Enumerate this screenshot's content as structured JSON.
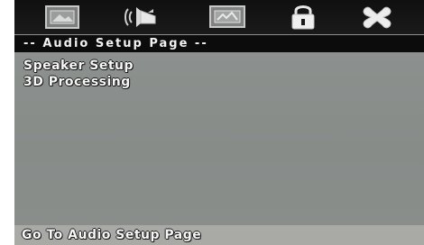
{
  "toolbar": {
    "icons": [
      {
        "name": "general-setup-icon"
      },
      {
        "name": "audio-setup-icon"
      },
      {
        "name": "video-setup-icon"
      },
      {
        "name": "preference-lock-icon"
      },
      {
        "name": "exit-icon"
      }
    ]
  },
  "header": {
    "title": "-- Audio Setup Page --"
  },
  "menu": {
    "items": [
      {
        "label": "Speaker Setup"
      },
      {
        "label": "3D Processing"
      }
    ]
  },
  "status": {
    "text": "Go To Audio Setup Page"
  },
  "colors": {
    "background": "#8a8e8b",
    "toolbar": "#111111",
    "header_bar": "#0c0c0c",
    "text": "#f6f6f6",
    "status_bar": "#a9a9a5"
  }
}
